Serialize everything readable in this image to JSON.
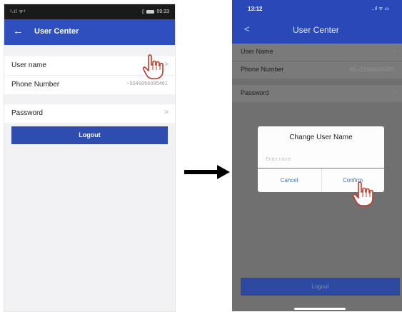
{
  "left_screen": {
    "status_left": "ᵌ.ıl ᯤᵌ",
    "status_right_time": "09:33",
    "nav_back": "←",
    "nav_title": "User Center",
    "rows": [
      {
        "label": "User name",
        "chevron": ">"
      },
      {
        "label": "Phone Number",
        "value": "~5549956095461"
      },
      {
        "label": "Password",
        "chevron": ">"
      }
    ],
    "logout_label": "Logout"
  },
  "right_screen": {
    "status_time": "13:12",
    "status_icons": "..ıl ᯤ ▭",
    "nav_back": "<",
    "nav_title": "User Center",
    "rows": [
      {
        "label": "User Name",
        "chevron": ">"
      },
      {
        "label": "Phone Number",
        "value": "86--15986095455"
      },
      {
        "label": "Password",
        "chevron": ">"
      }
    ],
    "dialog": {
      "title": "Change User Name",
      "input_placeholder": "Enter name",
      "input_value": "",
      "cancel_label": "Cancel",
      "confirm_label": "Confirm"
    },
    "logout_label": "Logout"
  },
  "icons": {
    "arrow": "right-arrow-icon",
    "pointer": "pointing-hand-icon"
  },
  "colors": {
    "nav_blue": "#2f4fbf",
    "button_blue": "#2e4daf",
    "dialog_accent": "#3b82c4",
    "pointer_red": "#c0392b"
  }
}
